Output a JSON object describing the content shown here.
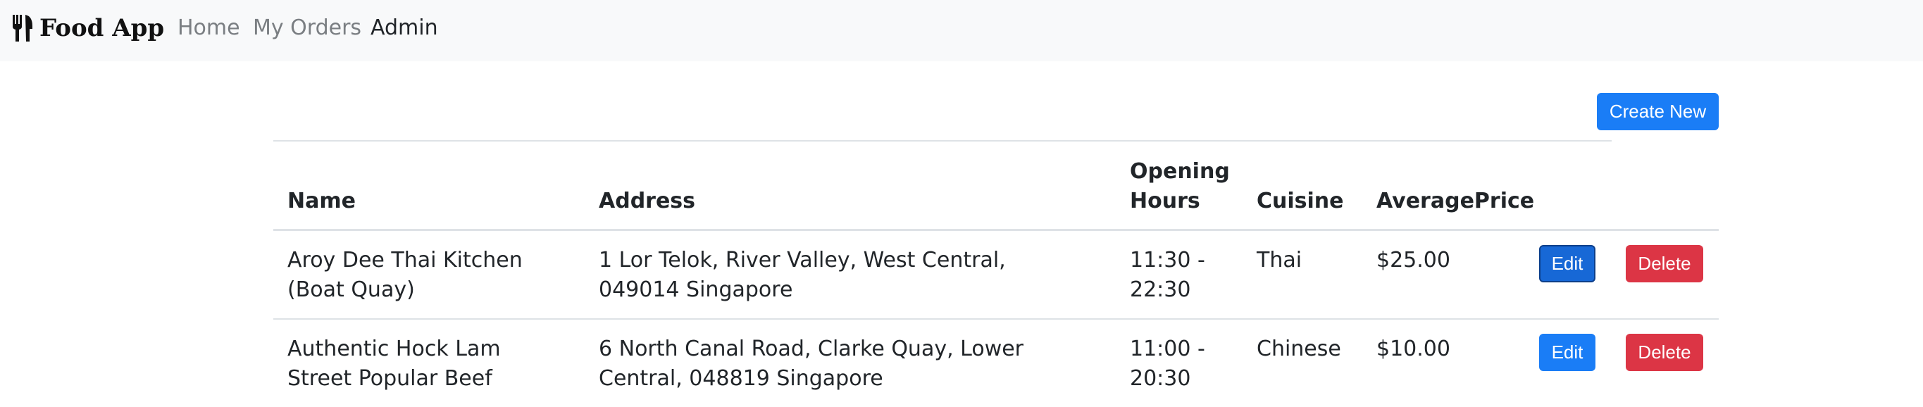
{
  "nav": {
    "brand": "Food App",
    "links": [
      {
        "label": "Home",
        "active": false
      },
      {
        "label": "My Orders",
        "active": false
      },
      {
        "label": "Admin",
        "active": true
      }
    ]
  },
  "actions": {
    "create_label": "Create New"
  },
  "table": {
    "headers": [
      "Name",
      "Address",
      "Opening Hours",
      "Cuisine",
      "AveragePrice"
    ],
    "rows": [
      {
        "name": "Aroy Dee Thai Kitchen (Boat Quay)",
        "address": "1 Lor Telok, River Valley, West Central, 049014 Singapore",
        "hours": "11:30 - 22:30",
        "cuisine": "Thai",
        "price": "$25.00"
      },
      {
        "name": "Authentic Hock Lam Street Popular Beef",
        "address": "6 North Canal Road, Clarke Quay, Lower Central, 048819 Singapore",
        "hours": "11:00 - 20:30",
        "cuisine": "Chinese",
        "price": "$10.00"
      }
    ],
    "edit_label": "Edit",
    "delete_label": "Delete"
  }
}
